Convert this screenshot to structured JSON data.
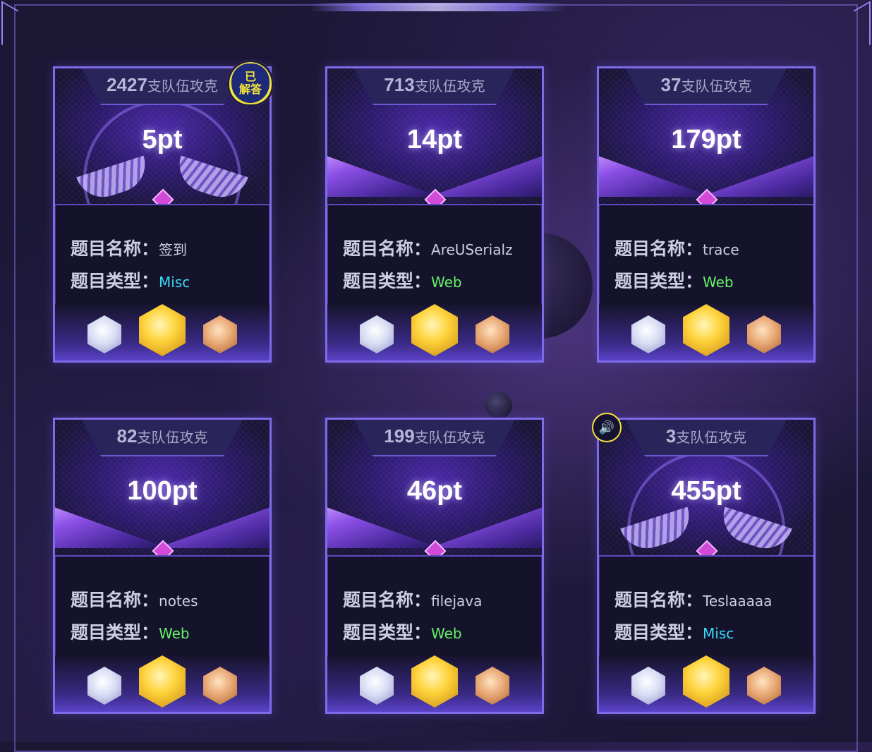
{
  "labels": {
    "name": "题目名称：",
    "type": "题目类型：",
    "teams_suffix": "支队伍攻克"
  },
  "solved_badge": "已\n解答",
  "cards": [
    {
      "teams": "2427",
      "points": "5pt",
      "name": "签到",
      "type": "Misc",
      "type_color": "#3ad8f4",
      "solved": true,
      "sound": false
    },
    {
      "teams": "713",
      "points": "14pt",
      "name": "AreUSerialz",
      "type": "Web",
      "type_color": "#64f266",
      "solved": false,
      "sound": false
    },
    {
      "teams": "37",
      "points": "179pt",
      "name": "trace",
      "type": "Web",
      "type_color": "#64f266",
      "solved": false,
      "sound": false
    },
    {
      "teams": "82",
      "points": "100pt",
      "name": "notes",
      "type": "Web",
      "type_color": "#64f266",
      "solved": false,
      "sound": false
    },
    {
      "teams": "199",
      "points": "46pt",
      "name": "filejava",
      "type": "Web",
      "type_color": "#64f266",
      "solved": false,
      "sound": false
    },
    {
      "teams": "3",
      "points": "455pt",
      "name": "Teslaaaaa",
      "type": "Misc",
      "type_color": "#3ad8f4",
      "solved": false,
      "sound": true
    }
  ]
}
